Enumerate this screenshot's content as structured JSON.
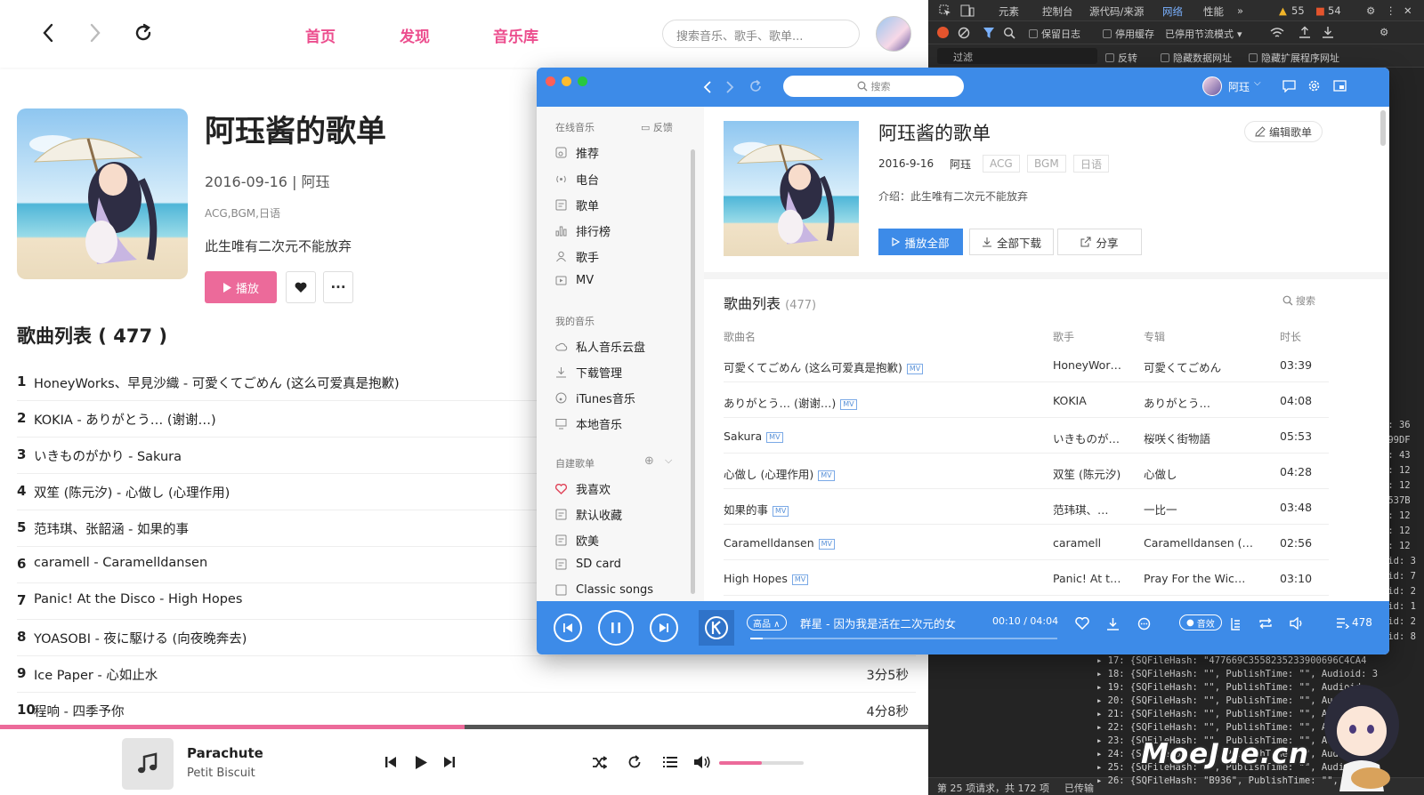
{
  "web": {
    "nav": {
      "home": "首页",
      "discover": "发现",
      "library": "音乐库"
    },
    "search_placeholder": "搜索音乐、歌手、歌单...",
    "playlist": {
      "title": "阿珏酱的歌单",
      "meta": "2016-09-16 | 阿珏",
      "tags": "ACG,BGM,日语",
      "description": "此生唯有二次元不能放弃",
      "play_label": "播放",
      "more_label": "···"
    },
    "list_title": "歌曲列表 ( 477 )",
    "songs": [
      {
        "num": "1",
        "title": "HoneyWorks、早見沙織 - 可愛くてごめん (这么可爱真是抱歉)",
        "duration": ""
      },
      {
        "num": "2",
        "title": "KOKIA - ありがとう… (谢谢…)",
        "duration": ""
      },
      {
        "num": "3",
        "title": "いきものがかり - Sakura",
        "duration": ""
      },
      {
        "num": "4",
        "title": "双笙 (陈元汐) - 心做し (心理作用)",
        "duration": ""
      },
      {
        "num": "5",
        "title": "范玮琪、张韶涵 - 如果的事",
        "duration": ""
      },
      {
        "num": "6",
        "title": "caramell - Caramelldansen",
        "duration": ""
      },
      {
        "num": "7",
        "title": "Panic! At the Disco - High Hopes",
        "duration": ""
      },
      {
        "num": "8",
        "title": "YOASOBI - 夜に駆ける (向夜晚奔去)",
        "duration": ""
      },
      {
        "num": "9",
        "title": "Ice Paper - 心如止水",
        "duration": "3分5秒"
      },
      {
        "num": "10",
        "title": "程响 - 四季予你",
        "duration": "4分8秒"
      }
    ],
    "player": {
      "title": "Parachute",
      "artist": "Petit Biscuit",
      "progress": 0.5,
      "volume": 0.5
    }
  },
  "devtools": {
    "tabs": [
      "元素",
      "控制台",
      "源代码/来源",
      "网络",
      "性能",
      "»"
    ],
    "warnings": "55",
    "errors": "54",
    "bar2": {
      "preserve_log": "保留日志",
      "disable_cache": "停用缓存",
      "throttle": "已停用节流模式"
    },
    "bar3": {
      "filter": "过滤",
      "invert": "反转",
      "hide_data_urls": "隐藏数据网址",
      "hide_ext_urls": "隐藏扩展程序网址"
    },
    "log_lines": [
      "▸ 17: {SQFileHash: \"477669C3558235233900696C4CA4",
      "▸ 18: {SQFileHash: \"\", PublishTime: \"\", Audioid: 3",
      "▸ 19: {SQFileHash: \"\", PublishTime: \"\", Audioid",
      "▸ 20: {SQFileHash: \"\", PublishTime: \"\", Audioid: 8",
      "▸ 21: {SQFileHash: \"\", PublishTime: \"\", Audioid: 9",
      "▸ 22: {SQFileHash: \"\", PublishTime: \"\", Audioid: 5",
      "▸ 23: {SQFileHash: \"\", PublishTime: \"\", Audioid: 4",
      "▸ 24: {SQFileHash: \"\", PublishTime: \"\", Audioid: 2",
      "▸ 25: {SQFileHash: \"\", PublishTime: \"\", Audioid: 1",
      "▸ 26: {SQFileHash: \"B936\", PublishTime: \"\", Audioid"
    ],
    "right_lines": [
      "d: 36",
      "F99DF",
      "d: 43",
      "d: 12",
      "d: 12",
      "1537B",
      "d: 12",
      "d: 12",
      "d: 12",
      "oid: 3",
      "oid: 7",
      "oid: 2",
      "oid: 1",
      "oid: 2",
      "oid: 8"
    ],
    "status": "第 25 项请求，共 172 项",
    "status2": "已传输",
    "watermark": "MoeJue.cn"
  },
  "kugou": {
    "search_placeholder": "搜索",
    "user": "阿珏",
    "sidebar": {
      "online_title": "在线音乐",
      "feedback": "反馈",
      "online": [
        "推荐",
        "电台",
        "歌单",
        "排行榜",
        "歌手",
        "MV"
      ],
      "mine_title": "我的音乐",
      "mine": [
        "私人音乐云盘",
        "下载管理",
        "iTunes音乐",
        "本地音乐"
      ],
      "custom_title": "自建歌单",
      "custom": [
        "我喜欢",
        "默认收藏",
        "欧美",
        "SD card",
        "Classic songs"
      ]
    },
    "playlist": {
      "title": "阿珏酱的歌单",
      "edit": "编辑歌单",
      "date": "2016-9-16",
      "tags": [
        "阿珏",
        "ACG",
        "BGM",
        "日语"
      ],
      "intro": "介绍：此生唯有二次元不能放弃",
      "play_all": "播放全部",
      "download_all": "全部下载",
      "share": "分享"
    },
    "list_title": "歌曲列表",
    "list_count": "(477)",
    "list_search": "搜索",
    "columns": {
      "name": "歌曲名",
      "artist": "歌手",
      "album": "专辑",
      "duration": "时长"
    },
    "mv_label": "MV",
    "songs": [
      {
        "name": "可愛くてごめん (这么可爱真是抱歉)",
        "artist": "HoneyWor…",
        "album": "可愛くてごめん",
        "duration": "03:39"
      },
      {
        "name": "ありがとう… (谢谢…)",
        "artist": "KOKIA",
        "album": "ありがとう…",
        "duration": "04:08"
      },
      {
        "name": "Sakura",
        "artist": "いきものが…",
        "album": "桜咲く街物語",
        "duration": "05:53"
      },
      {
        "name": "心做し (心理作用)",
        "artist": "双笙 (陈元汐)",
        "album": "心做し",
        "duration": "04:28"
      },
      {
        "name": "如果的事",
        "artist": "范玮琪、…",
        "album": "一比一",
        "duration": "03:48"
      },
      {
        "name": "Caramelldansen",
        "artist": "caramell",
        "album": "Caramelldansen (…",
        "duration": "02:56"
      },
      {
        "name": "High Hopes",
        "artist": "Panic! At t…",
        "album": "Pray For the Wic…",
        "duration": "03:10"
      }
    ],
    "player": {
      "quality": "高品 ∧",
      "song": "群星 - 因为我是活在二次元的女",
      "time": "00:10 / 04:04",
      "progress": 0.04,
      "sound_effect": "音效",
      "count": "478"
    }
  }
}
